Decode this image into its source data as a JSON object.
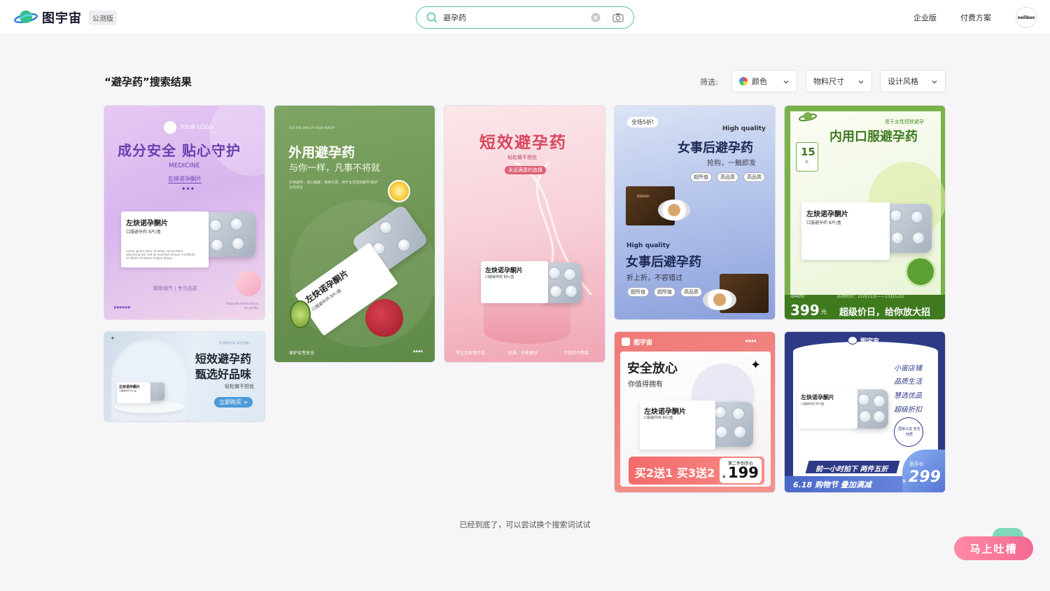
{
  "header": {
    "brand": "图宇宙",
    "beta_badge": "公测版",
    "search_value": "避孕药",
    "nav": [
      "企业版",
      "付费方案"
    ],
    "avatar_text": "nolibox"
  },
  "results": {
    "title": "“避孕药”搜索结果",
    "filter_label": "筛选:",
    "filters": [
      "颜色",
      "物料尺寸",
      "设计风格"
    ]
  },
  "cards": {
    "c1": {
      "logo": "YOUR LOGO",
      "headline": "成分安全 贴心守护",
      "sub": "MEDICINE",
      "product": "左炔诺孕酮片",
      "box_title": "左炔诺孕酮片",
      "box_sub": "口服避孕药  8片/盒",
      "box_lorem": "Lorem ipsum dolor sit amet, consectetur adipiscing elit, sed do eiusmod tempor incididunt ut labore et dolore magna aliqua.",
      "footer": "精致细节 | 专注品质",
      "footer_en": "Exquisite details Focus on quality"
    },
    "c2": {
      "headline": "外用避孕药",
      "sub": "与你一样，凡事不将就",
      "small": "外用避孕，安心健康，使用方便，用于女性短效避孕/保护女性安全",
      "box_title": "左炔诺孕酮片",
      "box_sub": "口服避孕药  8片/盒",
      "footer": "保护女性安全"
    },
    "c3": {
      "headline": "短效避孕药",
      "sub": "轻松做不担忧",
      "badge": "永远满意的选择",
      "box_title": "左炔诺孕酮片",
      "box_sub": "口服避孕药  8片/盒",
      "footer": [
        "专注为女性打造",
        "好质，才能更好",
        "不吃药不用套"
      ]
    },
    "c4": {
      "corner": "全场5折!",
      "hq": "High quality",
      "headline": "女事后避孕药",
      "sub": "抢购，一触即发",
      "tags": [
        "超所值",
        "高品质",
        "高品质"
      ],
      "hq2": "High quality",
      "headline2": "女事后避孕药",
      "sub2": "折上折，不容错过",
      "tags2": [
        "超所值",
        "超所值",
        "高品质"
      ],
      "brand": "BRAND"
    },
    "c5": {
      "top": "用于女性短效避孕",
      "headline": "内用口服避孕药",
      "days": "15",
      "days_unit": "天",
      "box_title": "左炔诺孕酮片",
      "box_sub": "口服避孕药  8片/盒",
      "promo_label": "活动价",
      "date": "活动时间：11月11日——11月12日",
      "price": "399",
      "price_unit": "元",
      "slogan": "超级价日，给你放大招"
    },
    "c6": {
      "top": "官方数字认证 安全可放心",
      "headline1": "短效避孕药",
      "headline2": "甄选好品味",
      "sub": "轻松做不担忧",
      "button": "立即购买 >",
      "box_title": "左炔诺孕酮片",
      "box_sub": "口服避孕药  8片/盒"
    },
    "c7": {
      "brand": "图宇宙",
      "headline": "安全放心",
      "sub": "你值得拥有",
      "box_title": "左炔诺孕酮片",
      "box_sub": "口服避孕药  8片/盒",
      "promo": "买2送1 买3送2",
      "price_label": "第二件到手价",
      "price": "199",
      "currency": "¥"
    },
    "c8": {
      "brand": "图宇宙",
      "lines": [
        "小宙店铺",
        "品质生活",
        "慧选优品",
        "超级折扣"
      ],
      "seal": "国家认证 安全材质",
      "box_title": "左炔诺孕酮片",
      "box_sub": "口服避孕药  8片/盒",
      "ribbon": "前一小时拍下 两件五折",
      "event": "6.18 购物节  叠加满减",
      "price_label": "到手价",
      "price": "299",
      "currency": "¥"
    }
  },
  "footer": {
    "end_text": "已经到底了，可以尝试换个搜索词试试",
    "feedback": "马上吐槽"
  },
  "colors": {
    "accent": "#5bc2a8",
    "feedback": "#f36a92"
  }
}
